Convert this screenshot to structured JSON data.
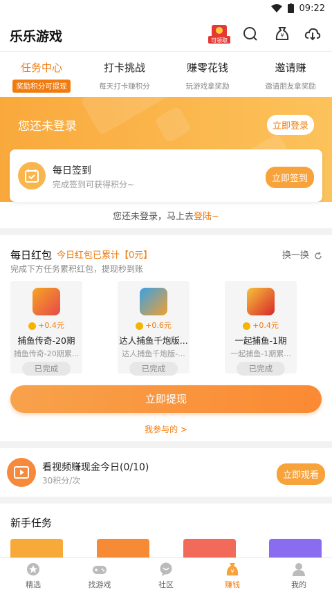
{
  "status": {
    "time": "09:22"
  },
  "app": {
    "title": "乐乐游戏",
    "redpack_label": "可领取"
  },
  "tabs": [
    {
      "title": "任务中心",
      "sub": "奖励积分可提现"
    },
    {
      "title": "打卡挑战",
      "sub": "每天打卡赚积分"
    },
    {
      "title": "赚零花钱",
      "sub": "玩游戏拿奖励"
    },
    {
      "title": "邀请赚",
      "sub": "邀请朋友拿奖励"
    }
  ],
  "hero": {
    "login_text": "您还未登录",
    "login_btn": "立即登录"
  },
  "signin": {
    "title": "每日签到",
    "subtitle": "完成签到可获得积分~",
    "btn": "立即签到"
  },
  "hint": {
    "text": "您还未登录，马上去",
    "link": "登陆~"
  },
  "redpacket": {
    "title": "每日红包",
    "accum": "今日红包已累计【0元】",
    "change": "换一换",
    "subtitle": "完成下方任务累积红包，提现秒到账",
    "games": [
      {
        "reward": "+0.4元",
        "name": "捕鱼传奇-20期",
        "desc": "捕鱼传奇-20期累...",
        "status": "已完成",
        "icon": "fish-game-icon",
        "color": "#e8474a"
      },
      {
        "reward": "+0.6元",
        "name": "达人捕鱼千炮版...",
        "desc": "达人捕鱼千炮版-...",
        "status": "已完成",
        "icon": "fish-1000-icon",
        "color": "#2f7fd6"
      },
      {
        "reward": "+0.4元",
        "name": "一起捕鱼-1期",
        "desc": "一起捕鱼-1期累...",
        "status": "已完成",
        "icon": "fish-together-icon",
        "color": "#d8272b"
      }
    ],
    "withdraw": "立即提现",
    "my_part": "我参与的 >"
  },
  "video": {
    "title": "看视频赚现金今日(0/10)",
    "sub": "30积分/次",
    "btn": "立即观看"
  },
  "newbie": {
    "title": "新手任务",
    "colors": [
      "#f7a93a",
      "#f78a34",
      "#f26a5a",
      "#8a6cf0"
    ]
  },
  "nav": [
    {
      "label": "精选",
      "icon": "star-icon"
    },
    {
      "label": "找游戏",
      "icon": "gamepad-icon"
    },
    {
      "label": "社区",
      "icon": "chat-icon"
    },
    {
      "label": "赚钱",
      "icon": "money-bag-icon"
    },
    {
      "label": "我的",
      "icon": "person-icon"
    }
  ]
}
